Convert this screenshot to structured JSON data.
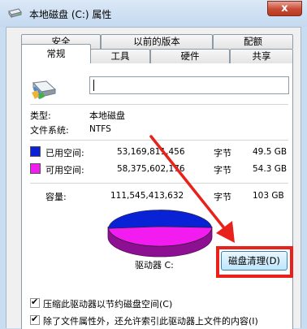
{
  "window": {
    "title": "本地磁盘 (C:) 属性",
    "close_glyph": "x"
  },
  "tabs": {
    "back_row": [
      "安全",
      "以前的版本",
      "配额"
    ],
    "front_row": [
      "常规",
      "工具",
      "硬件",
      "共享"
    ],
    "active": "常规"
  },
  "general": {
    "name_input_value": "",
    "type_label": "类型:",
    "type_value": "本地磁盘",
    "fs_label": "文件系统:",
    "fs_value": "NTFS",
    "used": {
      "label": "已用空间:",
      "bytes": "53,169,811,456",
      "unit": "字节",
      "size": "49.5 GB",
      "color": "#0a22d6"
    },
    "free": {
      "label": "可用空间:",
      "bytes": "58,375,602,176",
      "unit": "字节",
      "size": "54.3 GB",
      "color": "#f21cf0"
    },
    "capacity": {
      "label": "容量:",
      "bytes": "111,545,413,632",
      "unit": "字节",
      "size": "103 GB"
    },
    "drive_label": "驱动器 C:",
    "cleanup_button": "磁盘清理(D)",
    "compress_checkbox": "压缩此驱动器以节约磁盘空间(C)",
    "index_checkbox": "除了文件属性外，还允许索引此驱动器上文件的内容(I)"
  },
  "pie_data": {
    "used_gb": 49.5,
    "free_gb": 54.3
  },
  "annotation": {
    "arrow_color": "#e8211a"
  }
}
